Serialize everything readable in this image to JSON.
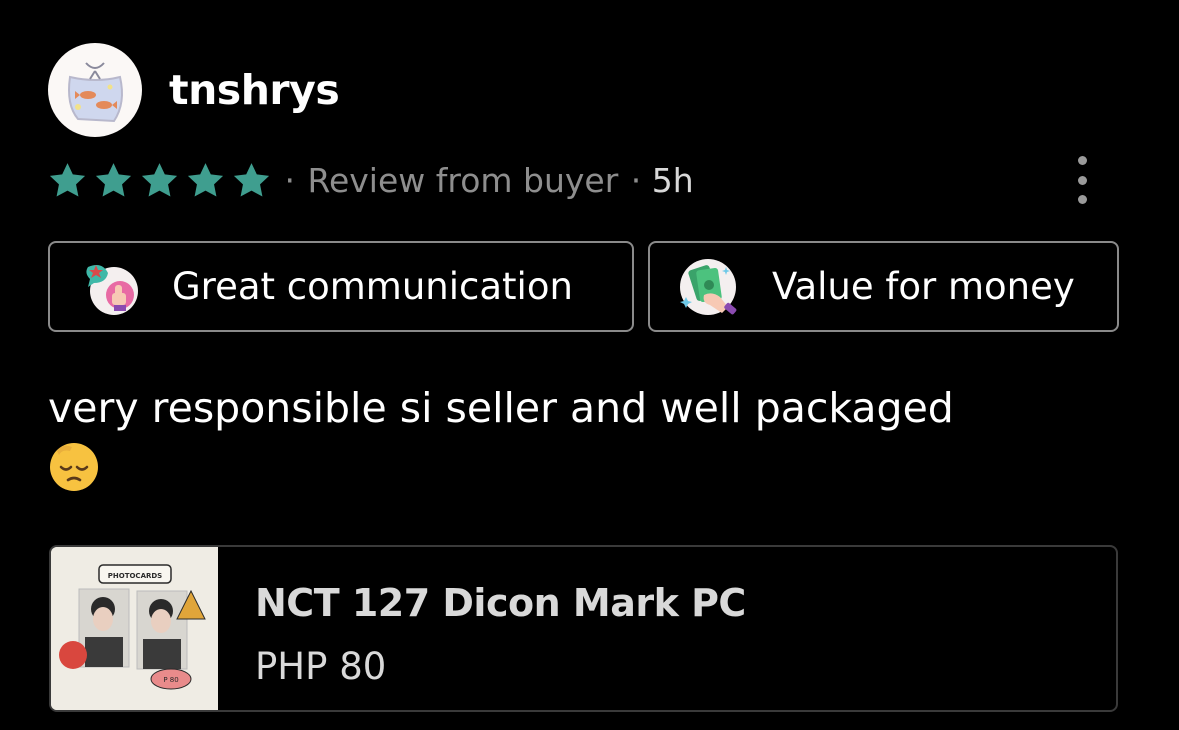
{
  "review": {
    "username": "tnshrys",
    "rating": 5,
    "rating_max": 5,
    "source": "Review from buyer",
    "time": "5h",
    "tags": [
      {
        "label": "Great communication",
        "icon": "communication-badge-icon"
      },
      {
        "label": "Value for money",
        "icon": "money-hand-icon"
      }
    ],
    "text": "very responsible si seller and well packaged",
    "emoji": "pensive-face-emoji",
    "separator": "·"
  },
  "product": {
    "name": "NCT 127 Dicon Mark PC",
    "price": "PHP 80",
    "thumb_text": {
      "header": "PHOTOCARDS",
      "price_tag": "P 80"
    }
  },
  "colors": {
    "background": "#000000",
    "star": "#3f9e8f",
    "meta": "#8e8e8e",
    "tag_border": "#8a8a8a"
  }
}
